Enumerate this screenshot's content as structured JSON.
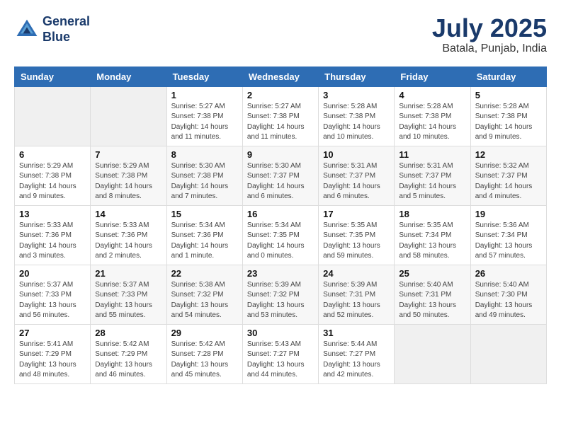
{
  "header": {
    "logo_line1": "General",
    "logo_line2": "Blue",
    "month": "July 2025",
    "location": "Batala, Punjab, India"
  },
  "days_of_week": [
    "Sunday",
    "Monday",
    "Tuesday",
    "Wednesday",
    "Thursday",
    "Friday",
    "Saturday"
  ],
  "weeks": [
    [
      {
        "day": "",
        "info": ""
      },
      {
        "day": "",
        "info": ""
      },
      {
        "day": "1",
        "info": "Sunrise: 5:27 AM\nSunset: 7:38 PM\nDaylight: 14 hours\nand 11 minutes."
      },
      {
        "day": "2",
        "info": "Sunrise: 5:27 AM\nSunset: 7:38 PM\nDaylight: 14 hours\nand 11 minutes."
      },
      {
        "day": "3",
        "info": "Sunrise: 5:28 AM\nSunset: 7:38 PM\nDaylight: 14 hours\nand 10 minutes."
      },
      {
        "day": "4",
        "info": "Sunrise: 5:28 AM\nSunset: 7:38 PM\nDaylight: 14 hours\nand 10 minutes."
      },
      {
        "day": "5",
        "info": "Sunrise: 5:28 AM\nSunset: 7:38 PM\nDaylight: 14 hours\nand 9 minutes."
      }
    ],
    [
      {
        "day": "6",
        "info": "Sunrise: 5:29 AM\nSunset: 7:38 PM\nDaylight: 14 hours\nand 9 minutes."
      },
      {
        "day": "7",
        "info": "Sunrise: 5:29 AM\nSunset: 7:38 PM\nDaylight: 14 hours\nand 8 minutes."
      },
      {
        "day": "8",
        "info": "Sunrise: 5:30 AM\nSunset: 7:38 PM\nDaylight: 14 hours\nand 7 minutes."
      },
      {
        "day": "9",
        "info": "Sunrise: 5:30 AM\nSunset: 7:37 PM\nDaylight: 14 hours\nand 6 minutes."
      },
      {
        "day": "10",
        "info": "Sunrise: 5:31 AM\nSunset: 7:37 PM\nDaylight: 14 hours\nand 6 minutes."
      },
      {
        "day": "11",
        "info": "Sunrise: 5:31 AM\nSunset: 7:37 PM\nDaylight: 14 hours\nand 5 minutes."
      },
      {
        "day": "12",
        "info": "Sunrise: 5:32 AM\nSunset: 7:37 PM\nDaylight: 14 hours\nand 4 minutes."
      }
    ],
    [
      {
        "day": "13",
        "info": "Sunrise: 5:33 AM\nSunset: 7:36 PM\nDaylight: 14 hours\nand 3 minutes."
      },
      {
        "day": "14",
        "info": "Sunrise: 5:33 AM\nSunset: 7:36 PM\nDaylight: 14 hours\nand 2 minutes."
      },
      {
        "day": "15",
        "info": "Sunrise: 5:34 AM\nSunset: 7:36 PM\nDaylight: 14 hours\nand 1 minute."
      },
      {
        "day": "16",
        "info": "Sunrise: 5:34 AM\nSunset: 7:35 PM\nDaylight: 14 hours\nand 0 minutes."
      },
      {
        "day": "17",
        "info": "Sunrise: 5:35 AM\nSunset: 7:35 PM\nDaylight: 13 hours\nand 59 minutes."
      },
      {
        "day": "18",
        "info": "Sunrise: 5:35 AM\nSunset: 7:34 PM\nDaylight: 13 hours\nand 58 minutes."
      },
      {
        "day": "19",
        "info": "Sunrise: 5:36 AM\nSunset: 7:34 PM\nDaylight: 13 hours\nand 57 minutes."
      }
    ],
    [
      {
        "day": "20",
        "info": "Sunrise: 5:37 AM\nSunset: 7:33 PM\nDaylight: 13 hours\nand 56 minutes."
      },
      {
        "day": "21",
        "info": "Sunrise: 5:37 AM\nSunset: 7:33 PM\nDaylight: 13 hours\nand 55 minutes."
      },
      {
        "day": "22",
        "info": "Sunrise: 5:38 AM\nSunset: 7:32 PM\nDaylight: 13 hours\nand 54 minutes."
      },
      {
        "day": "23",
        "info": "Sunrise: 5:39 AM\nSunset: 7:32 PM\nDaylight: 13 hours\nand 53 minutes."
      },
      {
        "day": "24",
        "info": "Sunrise: 5:39 AM\nSunset: 7:31 PM\nDaylight: 13 hours\nand 52 minutes."
      },
      {
        "day": "25",
        "info": "Sunrise: 5:40 AM\nSunset: 7:31 PM\nDaylight: 13 hours\nand 50 minutes."
      },
      {
        "day": "26",
        "info": "Sunrise: 5:40 AM\nSunset: 7:30 PM\nDaylight: 13 hours\nand 49 minutes."
      }
    ],
    [
      {
        "day": "27",
        "info": "Sunrise: 5:41 AM\nSunset: 7:29 PM\nDaylight: 13 hours\nand 48 minutes."
      },
      {
        "day": "28",
        "info": "Sunrise: 5:42 AM\nSunset: 7:29 PM\nDaylight: 13 hours\nand 46 minutes."
      },
      {
        "day": "29",
        "info": "Sunrise: 5:42 AM\nSunset: 7:28 PM\nDaylight: 13 hours\nand 45 minutes."
      },
      {
        "day": "30",
        "info": "Sunrise: 5:43 AM\nSunset: 7:27 PM\nDaylight: 13 hours\nand 44 minutes."
      },
      {
        "day": "31",
        "info": "Sunrise: 5:44 AM\nSunset: 7:27 PM\nDaylight: 13 hours\nand 42 minutes."
      },
      {
        "day": "",
        "info": ""
      },
      {
        "day": "",
        "info": ""
      }
    ]
  ]
}
